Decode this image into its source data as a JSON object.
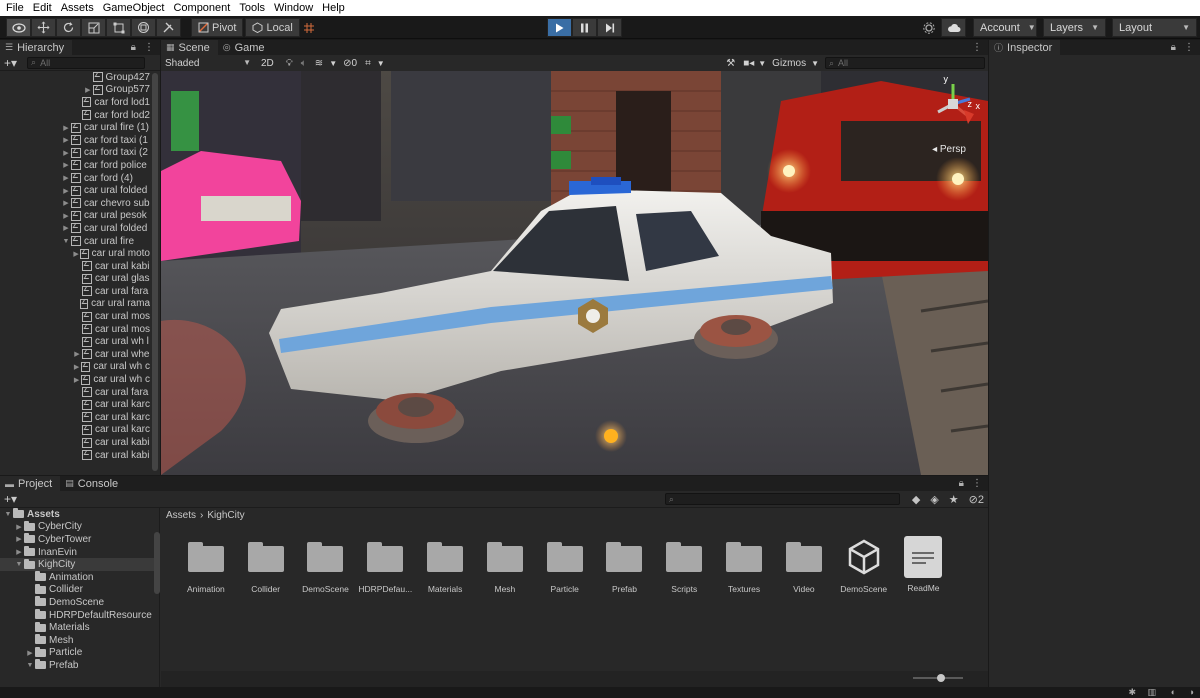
{
  "menu": [
    "File",
    "Edit",
    "Assets",
    "GameObject",
    "Component",
    "Tools",
    "Window",
    "Help"
  ],
  "toolbar": {
    "pivot_label": "Pivot",
    "local_label": "Local",
    "account_label": "Account",
    "layers_label": "Layers",
    "layout_label": "Layout"
  },
  "hierarchy": {
    "tab_label": "Hierarchy",
    "search_placeholder": "All",
    "items": [
      {
        "label": "Group427",
        "indent": 3,
        "arrow": false
      },
      {
        "label": "Group577",
        "indent": 3,
        "arrow": true
      },
      {
        "label": "car ford lod1",
        "indent": 2,
        "arrow": false
      },
      {
        "label": "car ford lod2",
        "indent": 2,
        "arrow": false
      },
      {
        "label": "car ural fire (1)",
        "indent": 1,
        "arrow": true
      },
      {
        "label": "car ford taxi (1",
        "indent": 1,
        "arrow": true
      },
      {
        "label": "car ford taxi (2",
        "indent": 1,
        "arrow": true
      },
      {
        "label": "car ford police",
        "indent": 1,
        "arrow": true
      },
      {
        "label": "car ford (4)",
        "indent": 1,
        "arrow": true
      },
      {
        "label": "car ural folded",
        "indent": 1,
        "arrow": true
      },
      {
        "label": "car chevro sub",
        "indent": 1,
        "arrow": true
      },
      {
        "label": "car ural pesok",
        "indent": 1,
        "arrow": true
      },
      {
        "label": "car ural folded",
        "indent": 1,
        "arrow": true
      },
      {
        "label": "car ural fire",
        "indent": 1,
        "arrow": true,
        "open": true
      },
      {
        "label": "car ural moto",
        "indent": 2,
        "arrow": true
      },
      {
        "label": "car ural kabi",
        "indent": 2,
        "arrow": false
      },
      {
        "label": "car ural glas",
        "indent": 2,
        "arrow": false
      },
      {
        "label": "car ural fara",
        "indent": 2,
        "arrow": false
      },
      {
        "label": "car ural rama",
        "indent": 2,
        "arrow": false
      },
      {
        "label": "car ural mos",
        "indent": 2,
        "arrow": false
      },
      {
        "label": "car ural mos",
        "indent": 2,
        "arrow": false
      },
      {
        "label": "car ural wh l",
        "indent": 2,
        "arrow": false
      },
      {
        "label": "car ural whe",
        "indent": 2,
        "arrow": true
      },
      {
        "label": "car ural wh c",
        "indent": 2,
        "arrow": true
      },
      {
        "label": "car ural wh c",
        "indent": 2,
        "arrow": true
      },
      {
        "label": "car ural fara",
        "indent": 2,
        "arrow": false
      },
      {
        "label": "car ural karc",
        "indent": 2,
        "arrow": false
      },
      {
        "label": "car ural karc",
        "indent": 2,
        "arrow": false
      },
      {
        "label": "car ural karc",
        "indent": 2,
        "arrow": false
      },
      {
        "label": "car ural kabi",
        "indent": 2,
        "arrow": false
      },
      {
        "label": "car ural kabi",
        "indent": 2,
        "arrow": false
      }
    ]
  },
  "scene": {
    "tabs": [
      {
        "label": "Scene"
      },
      {
        "label": "Game"
      }
    ],
    "shading_mode": "Shaded",
    "mode_2d_label": "2D",
    "hidden_count": "0",
    "gizmos_label": "Gizmos",
    "search_placeholder": "All",
    "persp_label": "Persp",
    "axis_y": "y",
    "axis_x": "x",
    "axis_z": "z"
  },
  "inspector": {
    "tab_label": "Inspector"
  },
  "project": {
    "tabs": [
      {
        "label": "Project"
      },
      {
        "label": "Console"
      }
    ],
    "layer_count": "2",
    "breadcrumb": {
      "root": "Assets",
      "current": "KighCity"
    },
    "tree": [
      {
        "label": "Assets",
        "indent": 0,
        "arrow": true,
        "open": true,
        "bold": true
      },
      {
        "label": "CyberCity",
        "indent": 1,
        "arrow": true
      },
      {
        "label": "CyberTower",
        "indent": 1,
        "arrow": true
      },
      {
        "label": "InanEvin",
        "indent": 1,
        "arrow": true
      },
      {
        "label": "KighCity",
        "indent": 1,
        "arrow": true,
        "open": true,
        "selected": true
      },
      {
        "label": "Animation",
        "indent": 2,
        "arrow": false
      },
      {
        "label": "Collider",
        "indent": 2,
        "arrow": false
      },
      {
        "label": "DemoScene",
        "indent": 2,
        "arrow": false
      },
      {
        "label": "HDRPDefaultResource",
        "indent": 2,
        "arrow": false
      },
      {
        "label": "Materials",
        "indent": 2,
        "arrow": false
      },
      {
        "label": "Mesh",
        "indent": 2,
        "arrow": false
      },
      {
        "label": "Particle",
        "indent": 2,
        "arrow": true
      },
      {
        "label": "Prefab",
        "indent": 2,
        "arrow": true,
        "open": true
      }
    ],
    "assets": [
      {
        "label": "Animation",
        "kind": "folder"
      },
      {
        "label": "Collider",
        "kind": "folder"
      },
      {
        "label": "DemoScene",
        "kind": "folder"
      },
      {
        "label": "HDRPDefau...",
        "kind": "folder"
      },
      {
        "label": "Materials",
        "kind": "folder"
      },
      {
        "label": "Mesh",
        "kind": "folder"
      },
      {
        "label": "Particle",
        "kind": "folder"
      },
      {
        "label": "Prefab",
        "kind": "folder"
      },
      {
        "label": "Scripts",
        "kind": "folder"
      },
      {
        "label": "Textures",
        "kind": "folder"
      },
      {
        "label": "Video",
        "kind": "folder"
      },
      {
        "label": "DemoScene",
        "kind": "unity-scene"
      },
      {
        "label": "ReadMe",
        "kind": "document"
      }
    ],
    "zoom": 0.55
  },
  "colors": {
    "accent_blue": "#3a6ea5",
    "panel_bg": "#282828",
    "selection": "#2c5d87"
  }
}
